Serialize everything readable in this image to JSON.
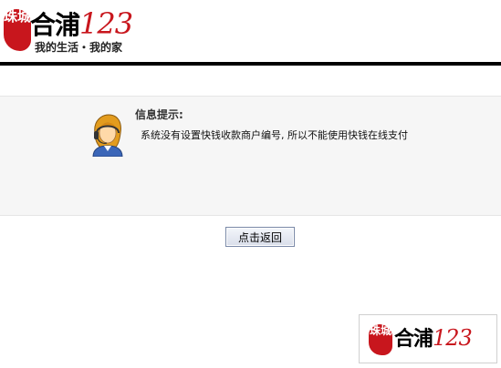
{
  "header": {
    "logo": {
      "seal_text": "珠城",
      "brand_text": "合浦",
      "brand_number": "123",
      "tagline": "我的生活・我的家"
    }
  },
  "message": {
    "title": "信息提示:",
    "body": "系统没有设置快钱收款商户编号, 所以不能使用快钱在线支付",
    "icon": "user-avatar-icon"
  },
  "actions": {
    "back_label": "点击返回"
  },
  "footer": {
    "logo": {
      "seal_text": "珠城",
      "brand_text": "合浦",
      "brand_number": "123"
    }
  },
  "colors": {
    "brand_red": "#c8161d",
    "panel_bg": "#f6f6f6",
    "rule": "#000000"
  }
}
